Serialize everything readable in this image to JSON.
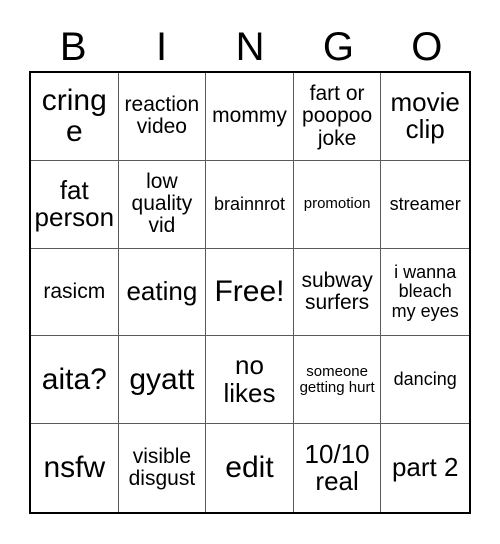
{
  "card": {
    "headers": [
      "B",
      "I",
      "N",
      "G",
      "O"
    ],
    "rows": [
      [
        {
          "text": "cringe",
          "size": "xl"
        },
        {
          "text": "reaction video",
          "size": "md"
        },
        {
          "text": "mommy",
          "size": "md"
        },
        {
          "text": "fart or poopoo joke",
          "size": "md"
        },
        {
          "text": "movie clip",
          "size": "lg"
        }
      ],
      [
        {
          "text": "fat person",
          "size": "lg"
        },
        {
          "text": "low quality vid",
          "size": "md"
        },
        {
          "text": "brainnrot",
          "size": "sm"
        },
        {
          "text": "promotion",
          "size": "xs"
        },
        {
          "text": "streamer",
          "size": "sm"
        }
      ],
      [
        {
          "text": "rasicm",
          "size": "md"
        },
        {
          "text": "eating",
          "size": "lg"
        },
        {
          "text": "Free!",
          "size": "xl"
        },
        {
          "text": "subway surfers",
          "size": "md"
        },
        {
          "text": "i wanna bleach my eyes",
          "size": "sm"
        }
      ],
      [
        {
          "text": "aita?",
          "size": "xl"
        },
        {
          "text": "gyatt",
          "size": "xl"
        },
        {
          "text": "no likes",
          "size": "lg"
        },
        {
          "text": "someone getting hurt",
          "size": "xs"
        },
        {
          "text": "dancing",
          "size": "sm"
        }
      ],
      [
        {
          "text": "nsfw",
          "size": "xl"
        },
        {
          "text": "visible disgust",
          "size": "md"
        },
        {
          "text": "edit",
          "size": "xl"
        },
        {
          "text": "10/10 real",
          "size": "lg"
        },
        {
          "text": "part 2",
          "size": "lg"
        }
      ]
    ]
  },
  "colors": {
    "background": "#ffffff",
    "text": "#000000",
    "outer_border": "#000000",
    "grid_line": "#5a5a5a"
  }
}
